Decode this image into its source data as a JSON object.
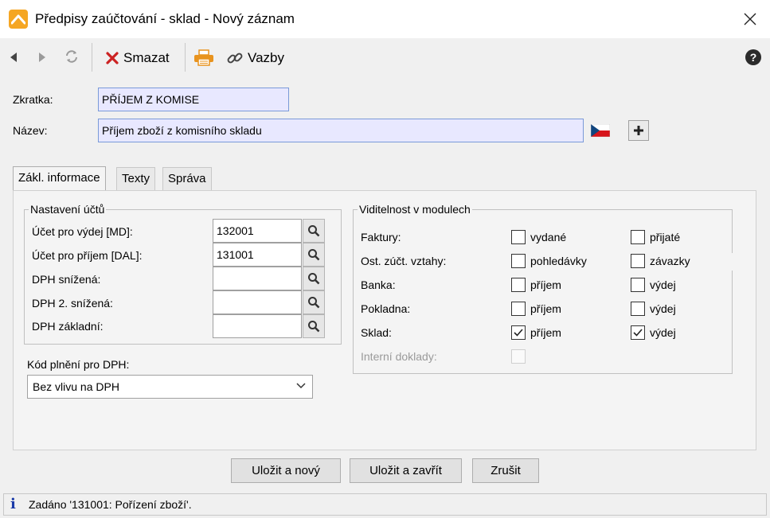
{
  "window": {
    "title": "Předpisy zaúčtování - sklad - Nový záznam"
  },
  "toolbar": {
    "delete_label": "Smazat",
    "links_label": "Vazby"
  },
  "form": {
    "shortcut_label": "Zkratka:",
    "shortcut_value": "PŘÍJEM Z KOMISE",
    "name_label": "Název:",
    "name_value": "Příjem zboží z komisního skladu"
  },
  "tabs": [
    {
      "label": "Zákl. informace",
      "active": true
    },
    {
      "label": "Texty",
      "active": false
    },
    {
      "label": "Správa",
      "active": false
    }
  ],
  "accounts": {
    "title": "Nastavení účtů",
    "rows": [
      {
        "label": "Účet pro výdej [MD]:",
        "value": "132001"
      },
      {
        "label": "Účet pro příjem [DAL]:",
        "value": "131001"
      },
      {
        "label": "DPH snížená:",
        "value": ""
      },
      {
        "label": "DPH 2. snížená:",
        "value": ""
      },
      {
        "label": "DPH základní:",
        "value": ""
      }
    ]
  },
  "vat_code": {
    "label": "Kód plnění pro DPH:",
    "selected": "Bez vlivu na DPH"
  },
  "visibility": {
    "title": "Viditelnost v modulech",
    "rows": [
      {
        "label": "Faktury:",
        "opt1": "vydané",
        "opt1_checked": false,
        "opt2": "přijaté",
        "opt2_checked": false
      },
      {
        "label": "Ost. zúčt. vztahy:",
        "opt1": "pohledávky",
        "opt1_checked": false,
        "opt2": "závazky",
        "opt2_checked": false
      },
      {
        "label": "Banka:",
        "opt1": "příjem",
        "opt1_checked": false,
        "opt2": "výdej",
        "opt2_checked": false
      },
      {
        "label": "Pokladna:",
        "opt1": "příjem",
        "opt1_checked": false,
        "opt2": "výdej",
        "opt2_checked": false
      },
      {
        "label": "Sklad:",
        "opt1": "příjem",
        "opt1_checked": true,
        "opt2": "výdej",
        "opt2_checked": true
      },
      {
        "label": "Interní doklady:",
        "disabled": true
      }
    ]
  },
  "buttons": {
    "save_new": "Uložit a nový",
    "save_close": "Uložit a zavřít",
    "cancel": "Zrušit"
  },
  "status": {
    "icon_glyph": "i",
    "text": "Zadáno '131001: Pořízení zboží'."
  },
  "colors": {
    "accent_field": "#e8e8ff",
    "delete_red": "#cc2222",
    "printer_orange": "#e8931e",
    "info_blue": "#1a3aa8"
  }
}
